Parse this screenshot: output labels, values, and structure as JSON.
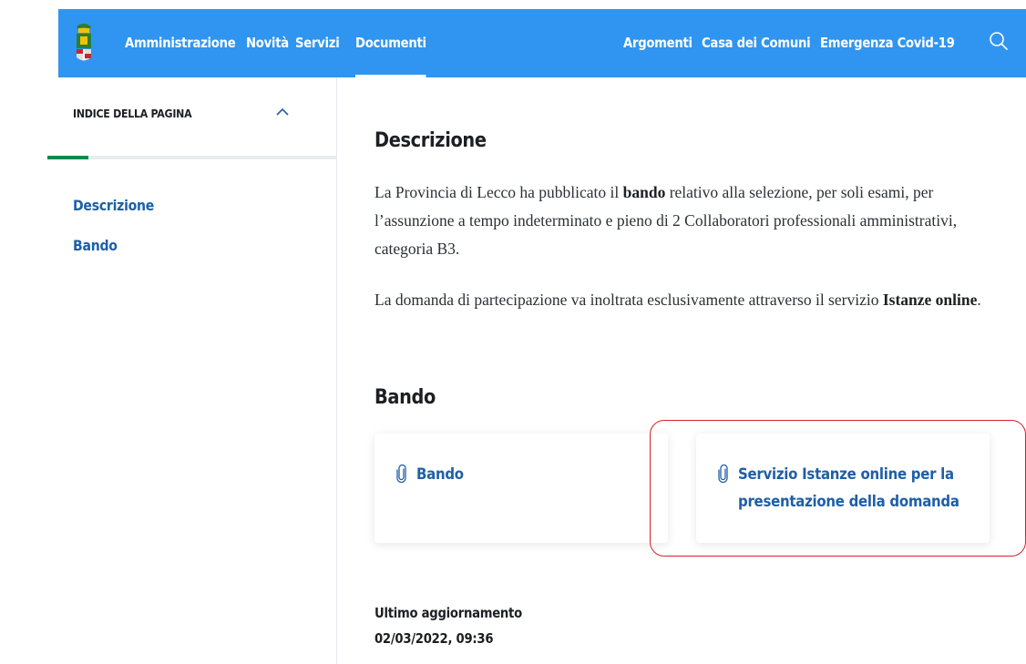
{
  "header": {
    "logo_icon": "provincia-di-lecco-coat-of-arms-icon",
    "nav_items": [
      {
        "label": "Amministrazione"
      },
      {
        "label": "Novità"
      },
      {
        "label": "Servizi"
      },
      {
        "label": "Documenti",
        "active": true
      },
      {
        "label": "Argomenti"
      },
      {
        "label": "Casa dei Comuni"
      },
      {
        "label": "Emergenza Covid-19"
      }
    ],
    "search_icon": "search-icon",
    "background_color": "#2f95f0"
  },
  "toc": {
    "title": "INDICE DELLA PAGINA",
    "toggle_icon": "chevron-up-icon",
    "progress": 0.14,
    "progress_color": "#0f8a4b",
    "links": [
      "Descrizione",
      "Bando"
    ]
  },
  "content": {
    "descrizione_heading": "Descrizione",
    "paragraph1": {
      "before": "La Provincia di Lecco ha pubblicato il ",
      "bold": "bando",
      "after": " relativo alla selezione, per soli esami, per l’assunzione a tempo indeterminato e pieno di 2 Collaboratori professionali amministrativi, categoria B3."
    },
    "paragraph2": {
      "before": "La domanda di partecipazione va inoltrata esclusivamente attraverso il servizio ",
      "bold": "Istanze online",
      "after": "."
    },
    "bando_heading": "Bando",
    "attachments": [
      {
        "title": "Bando",
        "icon": "paperclip-icon"
      },
      {
        "title": "Servizio Istanze online per la presentazione della domanda",
        "icon": "paperclip-icon",
        "highlighted": true
      }
    ],
    "highlight_color": "#d6222b",
    "last_updated_label": "Ultimo aggiornamento",
    "last_updated_value": "02/03/2022, 09:36"
  }
}
